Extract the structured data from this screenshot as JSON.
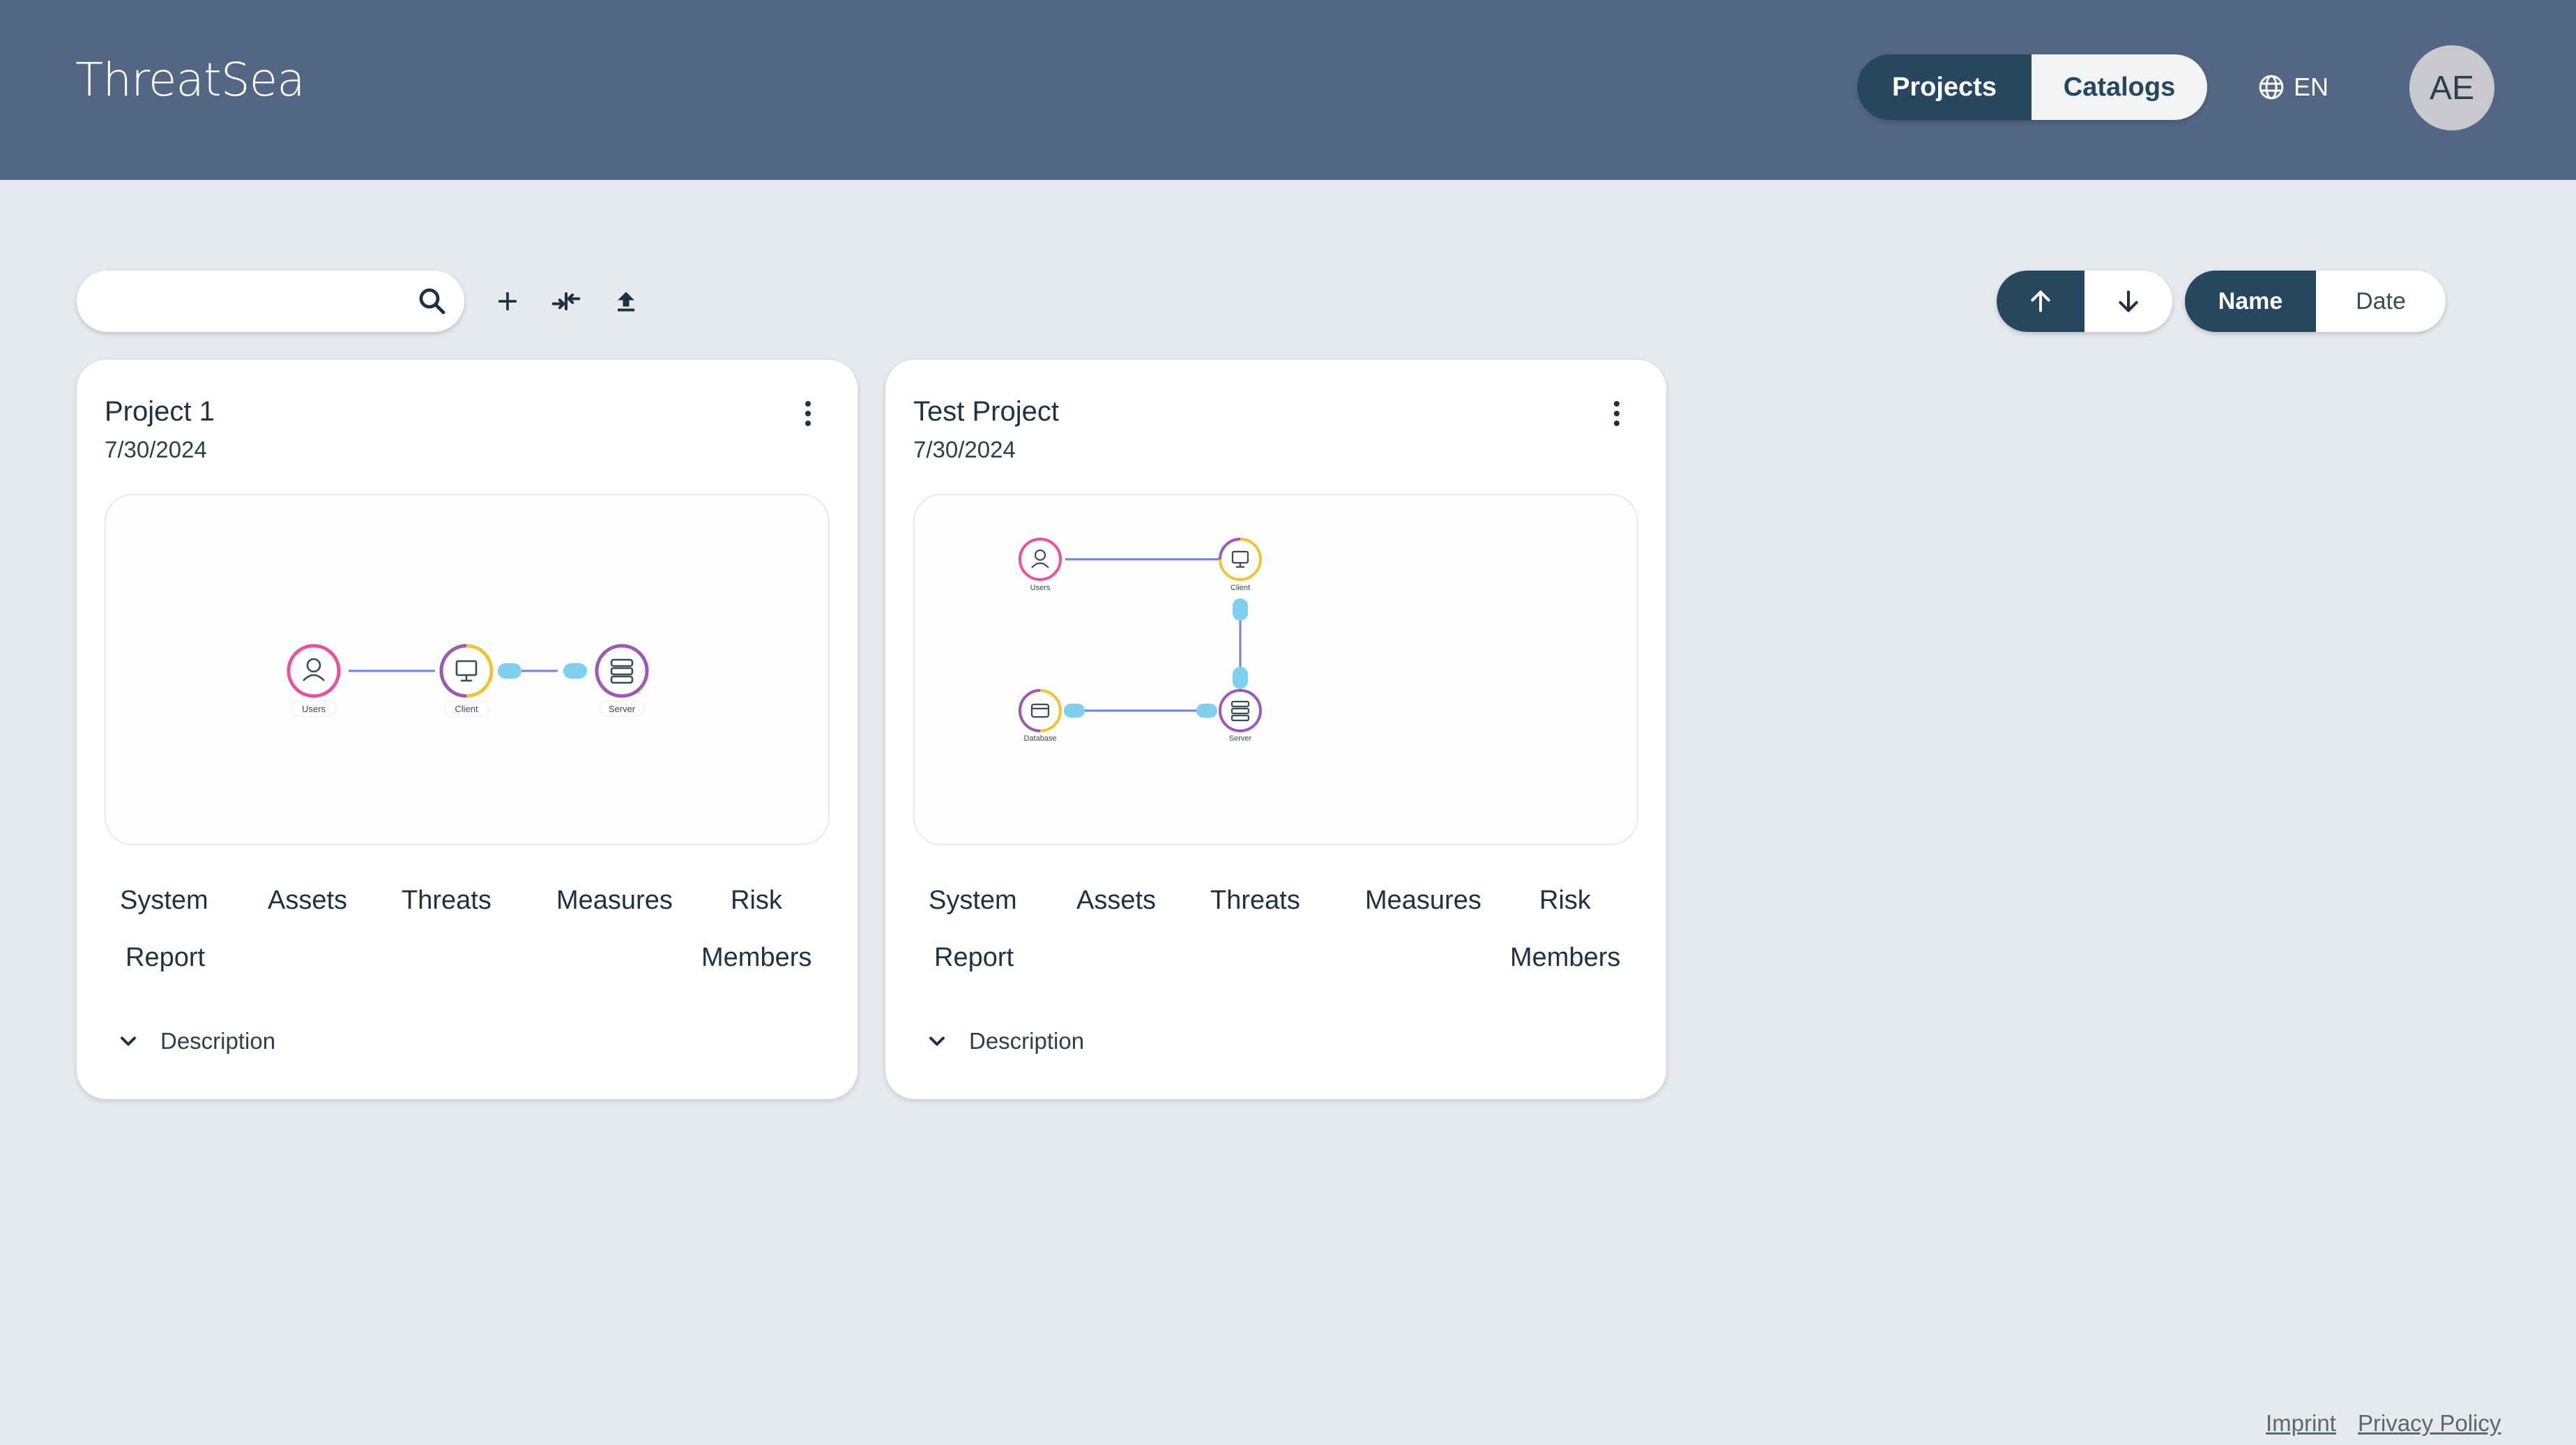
{
  "header": {
    "logo": "ThreatSea",
    "nav": [
      {
        "label": "Projects",
        "active": true
      },
      {
        "label": "Catalogs",
        "active": false
      }
    ],
    "language": "EN",
    "avatar_initials": "AE"
  },
  "toolbar": {
    "search_value": "",
    "search_placeholder": "",
    "sort_key_options": [
      {
        "label": "Name",
        "active": true
      },
      {
        "label": "Date",
        "active": false
      }
    ],
    "sort_direction": "ascending"
  },
  "projects": [
    {
      "title": "Project 1",
      "date": "7/30/2024",
      "links_row1": [
        "System",
        "Assets",
        "Threats",
        "Measures",
        "Risk"
      ],
      "links_row2": [
        "Report",
        "Members"
      ],
      "description_label": "Description",
      "diagram_nodes": [
        "Users",
        "Client",
        "Server"
      ]
    },
    {
      "title": "Test Project",
      "date": "7/30/2024",
      "links_row1": [
        "System",
        "Assets",
        "Threats",
        "Measures",
        "Risk"
      ],
      "links_row2": [
        "Report",
        "Members"
      ],
      "description_label": "Description",
      "diagram_nodes": [
        "Users",
        "Client",
        "Database",
        "Server"
      ]
    }
  ],
  "footer": {
    "imprint": "Imprint",
    "privacy": "Privacy Policy"
  },
  "colors": {
    "header_bg": "#536785",
    "primary": "#27475f",
    "page_bg": "#e6e9ee",
    "node_users": "#e8519b",
    "node_client": "#f1c232",
    "node_server": "#9b59b6",
    "connector": "#7fd0ee",
    "edge": "#6f7fe0"
  }
}
